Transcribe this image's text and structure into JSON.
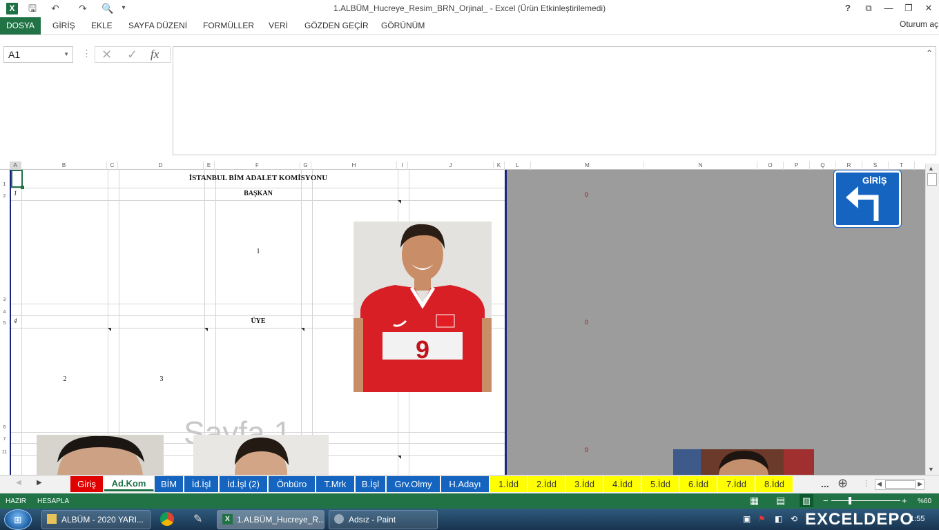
{
  "window": {
    "title": "1.ALBÜM_Hucreye_Resim_BRN_Orjinal_ - Excel (Ürün Etkinleştirilemedi)",
    "help": "?",
    "restore_ribbon": "⧉",
    "minimize": "—",
    "maximize": "❐",
    "close": "✕"
  },
  "quick_access": {
    "excel_icon": "X",
    "save": "🖫",
    "undo": "↶",
    "redo": "↷",
    "preview": "🔍",
    "more": "▾"
  },
  "ribbon": {
    "file_tab": "DOSYA",
    "tabs": [
      "GİRİŞ",
      "EKLE",
      "SAYFA DÜZENİ",
      "FORMÜLLER",
      "VERİ",
      "GÖZDEN GEÇİR",
      "GÖRÜNÜM"
    ],
    "signin": "Oturum aç"
  },
  "formula_bar": {
    "name_box": "A1",
    "cancel": "✕",
    "enter": "✓",
    "fx": "fx",
    "value": ""
  },
  "columns": [
    "A",
    "B",
    "C",
    "D",
    "E",
    "F",
    "G",
    "H",
    "I",
    "J",
    "K",
    "L",
    "M",
    "N",
    "O",
    "P",
    "Q",
    "R",
    "S",
    "T"
  ],
  "rows": [
    "1",
    "2",
    "3",
    "4",
    "5",
    "6",
    "7",
    "11"
  ],
  "sheet_content": {
    "header": "İSTANBUL BİM ADALET KOMİSYONU",
    "baskan_label": "BAŞKAN",
    "uye_label": "ÜYE",
    "num_1": "1",
    "num_2": "2",
    "num_3": "3",
    "row_mark_1": "1",
    "row_mark_4": "4",
    "page_watermark": "Sayfa 1",
    "right_zeros": [
      "0",
      "0",
      "0"
    ],
    "giris_button": "GİRİŞ"
  },
  "sheet_tabs": [
    {
      "label": "Giriş",
      "bg": "#e00000",
      "fg": "#ffffff"
    },
    {
      "label": "Ad.Kom",
      "bg": "#ffffff",
      "fg": "#1e7145",
      "active": true
    },
    {
      "label": "BİM",
      "bg": "#1565c0",
      "fg": "#ffffff"
    },
    {
      "label": "İd.İşl",
      "bg": "#1565c0",
      "fg": "#ffffff"
    },
    {
      "label": "İd.İşl (2)",
      "bg": "#1565c0",
      "fg": "#ffffff"
    },
    {
      "label": "Önbüro",
      "bg": "#1565c0",
      "fg": "#ffffff"
    },
    {
      "label": "T.Mrk",
      "bg": "#1565c0",
      "fg": "#ffffff"
    },
    {
      "label": "B.İşl",
      "bg": "#1565c0",
      "fg": "#ffffff"
    },
    {
      "label": "Grv.Olmy",
      "bg": "#1565c0",
      "fg": "#ffffff"
    },
    {
      "label": "H.Adayı",
      "bg": "#1565c0",
      "fg": "#ffffff"
    },
    {
      "label": "1.İdd",
      "bg": "#ffff00",
      "fg": "#333333"
    },
    {
      "label": "2.İdd",
      "bg": "#ffff00",
      "fg": "#333333"
    },
    {
      "label": "3.İdd",
      "bg": "#ffff00",
      "fg": "#333333"
    },
    {
      "label": "4.İdd",
      "bg": "#ffff00",
      "fg": "#333333"
    },
    {
      "label": "5.İdd",
      "bg": "#ffff00",
      "fg": "#333333"
    },
    {
      "label": "6.İdd",
      "bg": "#ffff00",
      "fg": "#333333"
    },
    {
      "label": "7.İdd",
      "bg": "#ffff00",
      "fg": "#333333"
    },
    {
      "label": "8.İdd",
      "bg": "#ffff00",
      "fg": "#333333"
    }
  ],
  "tabs_more": "...",
  "add_sheet": "⊕",
  "status": {
    "ready": "HAZIR",
    "calc": "HESAPLA",
    "zoom": "%60",
    "minus": "−",
    "plus": "+"
  },
  "taskbar": {
    "items": [
      "ALBÜM - 2020 YARI...",
      "1.ALBÜM_Hucreye_R...",
      "Adsız - Paint"
    ],
    "clock": "1:55",
    "watermark": "EXCELDEPO"
  },
  "colors": {
    "excel_green": "#217346",
    "tab_blue": "#1565c0",
    "tab_yellow": "#ffff00",
    "tab_red": "#e00000",
    "grey_area": "#9c9c9c"
  }
}
